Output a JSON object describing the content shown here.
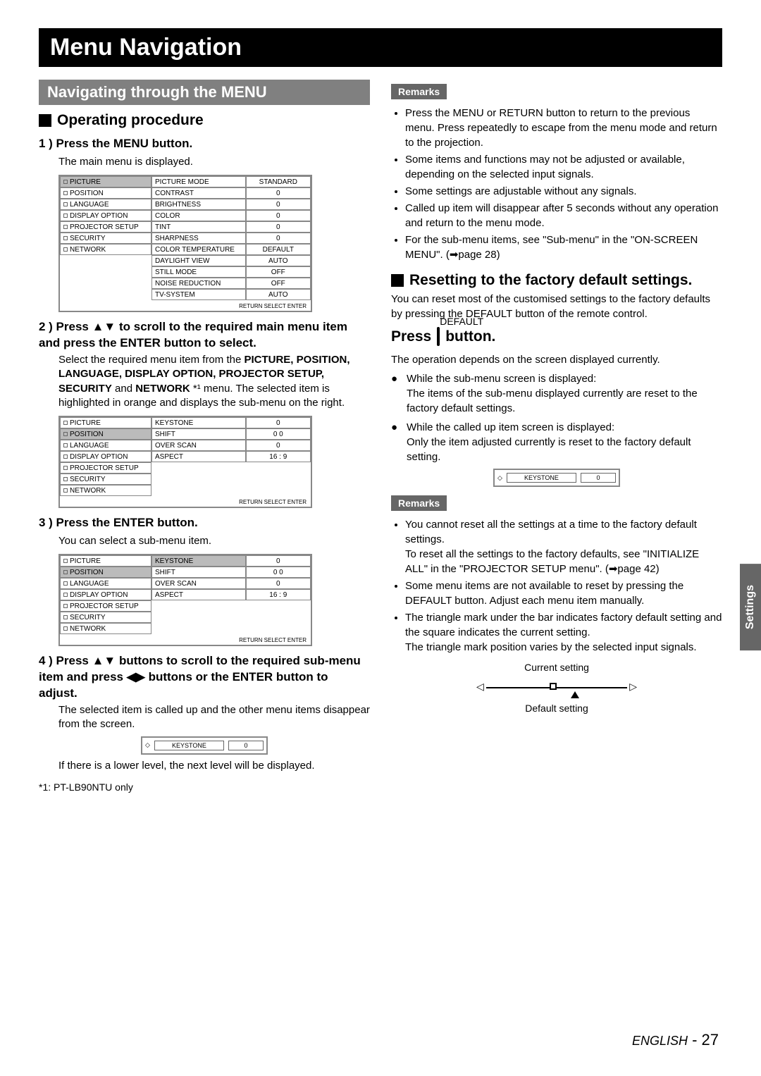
{
  "title": "Menu Navigation",
  "section": "Navigating through the MENU",
  "op_heading": "Operating procedure",
  "step1_h": "1 ) Press the MENU button.",
  "step1_body": "The main menu is displayed.",
  "menu1_left": [
    "PICTURE",
    "POSITION",
    "LANGUAGE",
    "DISPLAY OPTION",
    "PROJECTOR SETUP",
    "SECURITY",
    "NETWORK"
  ],
  "menu1_right": [
    [
      "PICTURE MODE",
      "STANDARD"
    ],
    [
      "CONTRAST",
      "0"
    ],
    [
      "BRIGHTNESS",
      "0"
    ],
    [
      "COLOR",
      "0"
    ],
    [
      "TINT",
      "0"
    ],
    [
      "SHARPNESS",
      "0"
    ],
    [
      "COLOR TEMPERATURE",
      "DEFAULT"
    ],
    [
      "DAYLIGHT VIEW",
      "AUTO"
    ],
    [
      "STILL MODE",
      "OFF"
    ],
    [
      "NOISE REDUCTION",
      "OFF"
    ],
    [
      "TV-SYSTEM",
      "AUTO"
    ]
  ],
  "nav_hint": "RETURN  SELECT  ENTER",
  "step2_h": "2 ) Press ▲▼ to scroll to the required main menu item and press the ENTER button to select.",
  "step2_body1": "Select the required menu item from the ",
  "step2_bold": "PICTURE, POSITION, LANGUAGE, DISPLAY OPTION, PROJECTOR SETUP, SECURITY",
  "step2_body2": " and ",
  "step2_bold2": "NETWORK",
  "step2_body3": " *¹ menu. The selected item is highlighted in orange and displays the sub-menu on the right.",
  "menu2_right": [
    [
      "KEYSTONE",
      "0"
    ],
    [
      "SHIFT",
      "0  0"
    ],
    [
      "OVER SCAN",
      "0"
    ],
    [
      "ASPECT",
      "16 : 9"
    ]
  ],
  "step3_h": "3 ) Press the ENTER button.",
  "step3_body": "You can select a sub-menu item.",
  "step4_h": "4 ) Press ▲▼ buttons to scroll to the required sub-menu item and press ◀▶ buttons or the ENTER button to adjust.",
  "step4_body": "The selected item is called up and the other menu items disappear from the screen.",
  "keystone_label": "KEYSTONE",
  "keystone_val": "0",
  "step4_tail": "If there is a lower level, the next level will be displayed.",
  "footnote1": "*1: PT-LB90NTU only",
  "remarks_label": "Remarks",
  "remarks1": [
    "Press the MENU or RETURN button to return to the previous menu. Press repeatedly to escape from the menu mode and return to the projection.",
    "Some items and functions may not be adjusted or available, depending on the selected input signals.",
    "Some settings are adjustable without any signals.",
    "Called up item will disappear after 5 seconds without any operation and return to the menu mode.",
    "For the sub-menu items, see \"Sub-menu\" in the \"ON-SCREEN MENU\". (➡page 28)"
  ],
  "reset_heading": "Resetting to the factory default settings.",
  "reset_intro": "You can reset most of the customised settings to the factory defaults by pressing the DEFAULT button of the remote control.",
  "press_word": "Press",
  "default_word": "DEFAULT",
  "button_word": "button.",
  "reset_depends": "The operation depends on the screen displayed currently.",
  "reset_circles": [
    "While the sub-menu screen is displayed:\nThe items of the sub-menu displayed currently are reset to the factory default settings.",
    "While the called up item screen is displayed:\nOnly the item adjusted currently is reset to the factory default setting."
  ],
  "remarks2": [
    "You cannot reset all the settings at a time to the factory default settings.\nTo reset all the settings to the factory defaults, see \"INITIALIZE ALL\" in the \"PROJECTOR SETUP menu\". (➡page 42)",
    "Some menu items are not available to reset by pressing the DEFAULT button. Adjust each menu item manually.",
    "The triangle mark under the bar indicates factory default setting and the square indicates the current setting.\nThe triangle mark position varies by the selected input signals."
  ],
  "current_setting": "Current setting",
  "default_setting": "Default setting",
  "side_tab": "Settings",
  "footer_lang": "ENGLISH",
  "footer_page": " - 27"
}
